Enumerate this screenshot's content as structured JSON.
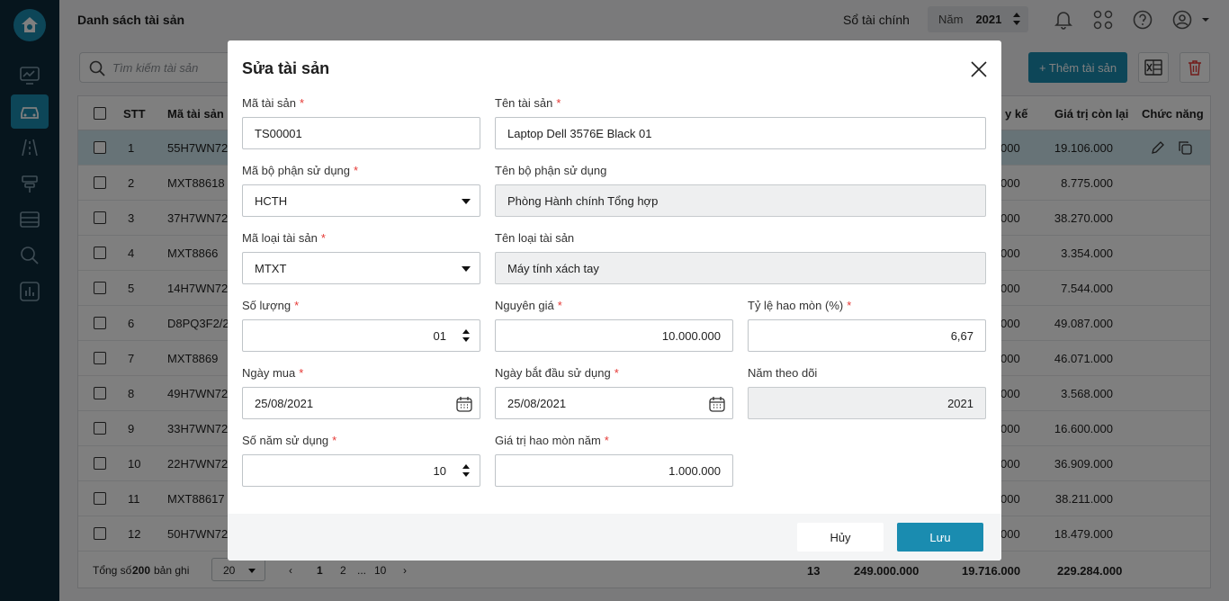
{
  "header": {
    "page_title": "Danh sách tài sản",
    "ledger_label": "Sổ tài chính",
    "year_label": "Năm",
    "year_value": "2021"
  },
  "toolbar": {
    "search_placeholder": "Tìm kiếm tài sản",
    "add_label": "+ Thêm tài sản"
  },
  "table": {
    "columns": {
      "stt": "STT",
      "code": "Mã tài sản",
      "accum": "y kế",
      "remaining": "Giá trị còn lại",
      "actions": "Chức năng"
    },
    "rows": [
      {
        "stt": "1",
        "code": "55H7WN72",
        "accum": "000",
        "remaining": "19.106.000"
      },
      {
        "stt": "2",
        "code": "MXT88618",
        "accum": "000",
        "remaining": "8.775.000"
      },
      {
        "stt": "3",
        "code": "37H7WN72",
        "accum": "000",
        "remaining": "38.270.000"
      },
      {
        "stt": "4",
        "code": "MXT8866",
        "accum": "000",
        "remaining": "3.354.000"
      },
      {
        "stt": "5",
        "code": "14H7WN72",
        "accum": "000",
        "remaining": "7.544.000"
      },
      {
        "stt": "6",
        "code": "D8PQ3F2/2",
        "accum": "000",
        "remaining": "49.087.000"
      },
      {
        "stt": "7",
        "code": "MXT8869",
        "accum": "000",
        "remaining": "46.071.000"
      },
      {
        "stt": "8",
        "code": "49H7WN72",
        "accum": "000",
        "remaining": "3.568.000"
      },
      {
        "stt": "9",
        "code": "33H7WN72",
        "accum": "000",
        "remaining": "16.600.000"
      },
      {
        "stt": "10",
        "code": "22H7WN72",
        "accum": "000",
        "remaining": "36.909.000"
      },
      {
        "stt": "11",
        "code": "MXT88617",
        "accum": "000",
        "remaining": "38.211.000"
      },
      {
        "stt": "12",
        "code": "50H7WN72",
        "accum": "000",
        "remaining": "18.479.000"
      }
    ],
    "footer": {
      "total_prefix": "Tổng số:",
      "total_count": "200",
      "total_suffix": "bản ghi",
      "page_size": "20",
      "pages": [
        "1",
        "2",
        "...",
        "10"
      ],
      "sum_qty": "13",
      "sum_cost": "249.000.000",
      "sum_accum": "19.716.000",
      "sum_remaining": "229.284.000"
    }
  },
  "modal": {
    "title": "Sửa tài sản",
    "fields": {
      "asset_code": {
        "label": "Mã tài sản",
        "value": "TS00001"
      },
      "asset_name": {
        "label": "Tên tài sản",
        "value": "Laptop Dell 3576E Black 01"
      },
      "dept_code": {
        "label": "Mã bộ phận sử dụng",
        "value": "HCTH"
      },
      "dept_name": {
        "label": "Tên bộ phận sử dụng",
        "value": "Phòng Hành chính Tổng hợp"
      },
      "type_code": {
        "label": "Mã loại tài sản",
        "value": "MTXT"
      },
      "type_name": {
        "label": "Tên loại tài sản",
        "value": "Máy tính xách tay"
      },
      "quantity": {
        "label": "Số lượng",
        "value": "01"
      },
      "cost": {
        "label": "Nguyên giá",
        "value": "10.000.000"
      },
      "depreciation_rate": {
        "label": "Tỷ lệ hao mòn (%)",
        "value": "6,67"
      },
      "purchase_date": {
        "label": "Ngày mua",
        "value": "25/08/2021"
      },
      "start_date": {
        "label": "Ngày bắt đầu sử dụng",
        "value": "25/08/2021"
      },
      "tracking_year": {
        "label": "Năm theo dõi",
        "value": "2021"
      },
      "years_of_use": {
        "label": "Số năm sử dụng",
        "value": "10"
      },
      "annual_depreciation": {
        "label": "Giá trị hao mòn năm",
        "value": "1.000.000"
      }
    },
    "required_mark": "*",
    "cancel_label": "Hủy",
    "save_label": "Lưu"
  },
  "colors": {
    "primary": "#1a8cb0",
    "sidebar": "#0d2a3b",
    "required": "#e53935"
  }
}
